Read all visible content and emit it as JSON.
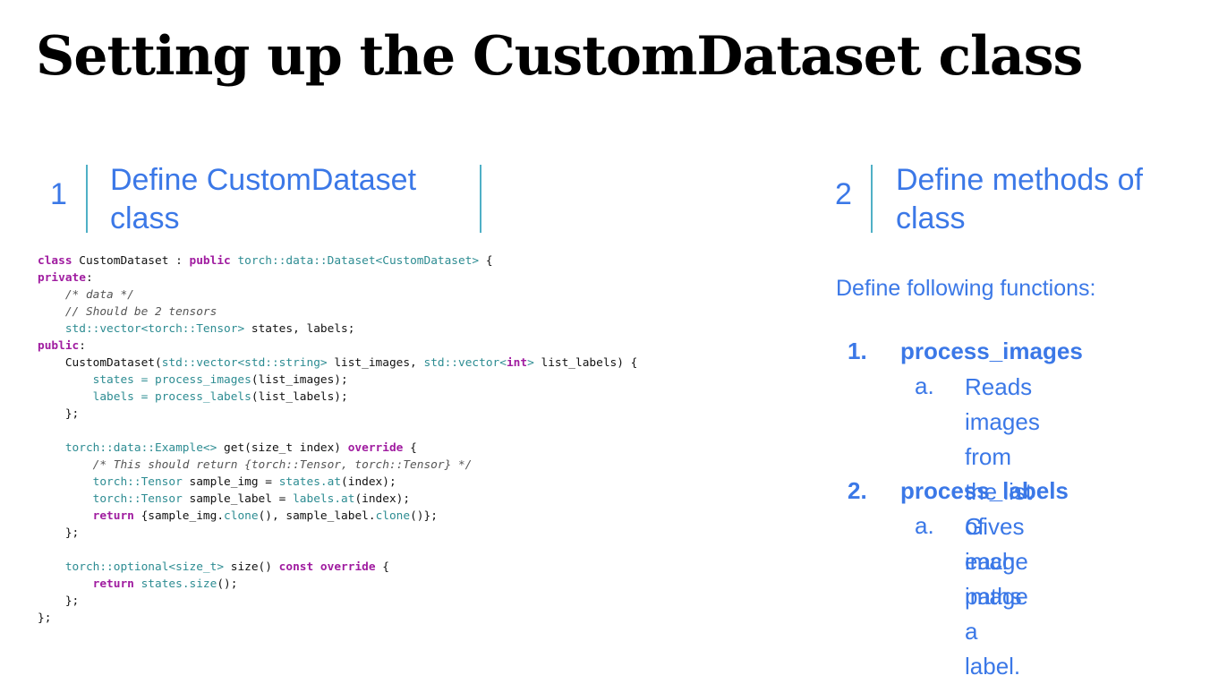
{
  "title": "Setting up the CustomDataset class",
  "section1": {
    "number": "1",
    "heading": [
      "Define CustomDataset",
      "class"
    ]
  },
  "section2": {
    "number": "2",
    "heading": [
      "Define methods of",
      "class"
    ]
  },
  "intro": "Define following functions:",
  "functions": [
    {
      "number": "1.",
      "name": "process_images",
      "sub_letter": "a.",
      "sub_lines": [
        "Reads images",
        "from the list of",
        "image paths"
      ]
    },
    {
      "number": "2.",
      "name": "process_labels",
      "sub_letter": "a.",
      "sub_lines": [
        "Gives each image",
        "a label."
      ]
    }
  ],
  "code": {
    "l1": [
      "class",
      " CustomDataset : ",
      "public",
      " ",
      "torch::data::Dataset<CustomDataset>",
      " {"
    ],
    "l2": [
      "private",
      ":"
    ],
    "l3": [
      "/* data */"
    ],
    "l4": [
      "// Should be 2 tensors"
    ],
    "l5": [
      "std::vector<torch::Tensor>",
      " states, labels;"
    ],
    "l6": [
      "public",
      ":"
    ],
    "l7": [
      "CustomDataset(",
      "std::vector<std::string>",
      " list_images, ",
      "std::vector<",
      "int",
      ">",
      " list_labels) {"
    ],
    "l8": [
      "states = ",
      "process_images",
      "(list_images);"
    ],
    "l9": [
      "labels = ",
      "process_labels",
      "(list_labels);"
    ],
    "l10": [
      "};"
    ],
    "l11": [
      "torch::data::Example<>",
      " get(size_t index) ",
      "override",
      " {"
    ],
    "l12": [
      "/* This should return {torch::Tensor, torch::Tensor} */"
    ],
    "l13": [
      "torch::Tensor",
      " sample_img = ",
      "states.at",
      "(index);"
    ],
    "l14": [
      "torch::Tensor",
      " sample_label = ",
      "labels.at",
      "(index);"
    ],
    "l15": [
      "return",
      " {sample_img.",
      "clone",
      "(), sample_label.",
      "clone",
      "()};"
    ],
    "l16": [
      "};"
    ],
    "l17": [
      "torch::optional<size_t>",
      " size() ",
      "const",
      " ",
      "override",
      " {"
    ],
    "l18": [
      "return",
      " ",
      "states.size",
      "();"
    ],
    "l19": [
      "};"
    ],
    "l20": [
      "};"
    ]
  }
}
